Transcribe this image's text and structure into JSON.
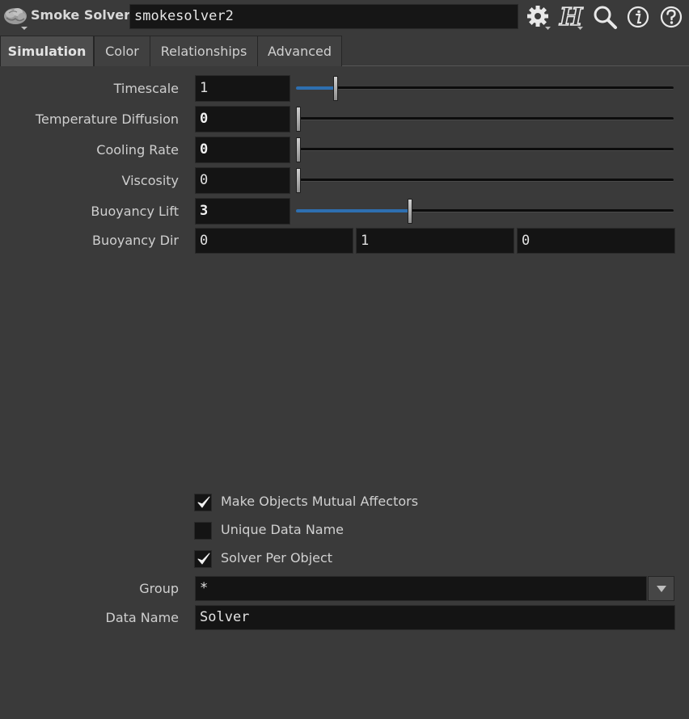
{
  "header": {
    "node_type": "Smoke Solver",
    "node_name": "smokesolver2",
    "icons": [
      "smoke-node-icon",
      "gear-icon",
      "houdini-help-icon",
      "search-icon",
      "info-icon",
      "help-icon"
    ]
  },
  "tabs": [
    {
      "label": "Simulation",
      "active": true
    },
    {
      "label": "Color",
      "active": false
    },
    {
      "label": "Relationships",
      "active": false
    },
    {
      "label": "Advanced",
      "active": false
    }
  ],
  "params": {
    "timescale": {
      "label": "Timescale",
      "value": "1",
      "slider": 0.1
    },
    "temperature_diffusion": {
      "label": "Temperature Diffusion",
      "value": "0",
      "slider": 0.0
    },
    "cooling_rate": {
      "label": "Cooling Rate",
      "value": "0",
      "slider": 0.0
    },
    "viscosity": {
      "label": "Viscosity",
      "value": "0",
      "slider": 0.0
    },
    "buoyancy_lift": {
      "label": "Buoyancy Lift",
      "value": "3",
      "slider": 0.3
    },
    "buoyancy_dir": {
      "label": "Buoyancy Dir",
      "x": "0",
      "y": "1",
      "z": "0"
    },
    "mutual_affectors": {
      "label": "Make Objects Mutual Affectors",
      "checked": true
    },
    "unique_data_name": {
      "label": "Unique Data Name",
      "checked": false
    },
    "solver_per_object": {
      "label": "Solver Per Object",
      "checked": true
    },
    "group": {
      "label": "Group",
      "value": "*"
    },
    "data_name": {
      "label": "Data Name",
      "value": "Solver"
    }
  },
  "colors": {
    "background": "#3a3a3a",
    "field": "#141414",
    "slider_fill": "#2e6fb0"
  }
}
